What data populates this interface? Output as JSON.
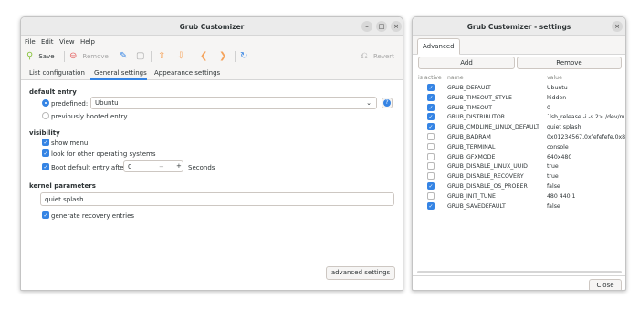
{
  "main": {
    "title": "Grub Customizer",
    "controls": {
      "minimize": "–",
      "maximize": "□",
      "close": "×"
    },
    "menu": [
      "File",
      "Edit",
      "View",
      "Help"
    ],
    "toolbar": {
      "save": "Save",
      "remove": "Remove",
      "revert": "Revert"
    },
    "tabs": [
      "List configuration",
      "General settings",
      "Appearance settings"
    ],
    "active_tab": "General settings",
    "default_entry": {
      "heading": "default entry",
      "predefined_label": "predefined:",
      "predefined_value": "Ubuntu",
      "previously_booted": "previously booted entry"
    },
    "visibility": {
      "heading": "visibility",
      "show_menu": "show menu",
      "look_for_os": "look for other operating systems",
      "boot_after": "Boot default entry after",
      "seconds_value": "0",
      "seconds_label": "Seconds",
      "minus": "−",
      "plus": "+"
    },
    "kernel": {
      "heading": "kernel parameters",
      "value": "quiet splash",
      "recovery": "generate recovery entries"
    },
    "advanced_button": "advanced settings"
  },
  "settings": {
    "title": "Grub Customizer - settings",
    "close_x": "×",
    "tab": "Advanced",
    "add": "Add",
    "remove": "Remove",
    "headers": {
      "active": "is active",
      "name": "name",
      "value": "value"
    },
    "rows": [
      {
        "active": true,
        "name": "GRUB_DEFAULT",
        "value": "Ubuntu"
      },
      {
        "active": true,
        "name": "GRUB_TIMEOUT_STYLE",
        "value": "hidden"
      },
      {
        "active": true,
        "name": "GRUB_TIMEOUT",
        "value": "0"
      },
      {
        "active": true,
        "name": "GRUB_DISTRIBUTOR",
        "value": "`lsb_release -i -s 2> /dev/nu"
      },
      {
        "active": true,
        "name": "GRUB_CMDLINE_LINUX_DEFAULT",
        "value": "quiet splash"
      },
      {
        "active": false,
        "name": "GRUB_BADRAM",
        "value": "0x01234567,0xfefefefe,0x8"
      },
      {
        "active": false,
        "name": "GRUB_TERMINAL",
        "value": "console"
      },
      {
        "active": false,
        "name": "GRUB_GFXMODE",
        "value": "640x480"
      },
      {
        "active": false,
        "name": "GRUB_DISABLE_LINUX_UUID",
        "value": "true"
      },
      {
        "active": false,
        "name": "GRUB_DISABLE_RECOVERY",
        "value": "true"
      },
      {
        "active": true,
        "name": "GRUB_DISABLE_OS_PROBER",
        "value": "false"
      },
      {
        "active": false,
        "name": "GRUB_INIT_TUNE",
        "value": "480 440 1"
      },
      {
        "active": true,
        "name": "GRUB_SAVEDEFAULT",
        "value": "false"
      }
    ],
    "close_button": "Close"
  },
  "colors": {
    "accent": "#3584e4",
    "arrow": "#f5a35b",
    "refresh": "#3584e4"
  },
  "icons": [
    "save-icon",
    "remove-icon",
    "edit-icon",
    "create-entry-icon",
    "move-up-icon",
    "move-down-icon",
    "move-left-icon",
    "move-right-icon",
    "refresh-icon",
    "revert-icon",
    "info-icon",
    "dropdown-icon"
  ]
}
